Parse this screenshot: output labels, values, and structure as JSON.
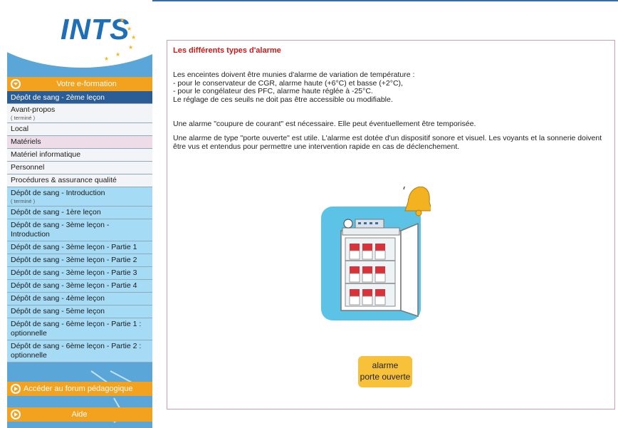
{
  "logo": {
    "text": "INTS"
  },
  "sidebar": {
    "formation_label": "Votre e-formation",
    "items": [
      {
        "label": "Dépôt de sang - 2ème leçon",
        "style": "active"
      },
      {
        "label": "Avant-propos",
        "sub": "( terminé )",
        "style": "white"
      },
      {
        "label": "Local",
        "style": "white"
      },
      {
        "label": "Matériels",
        "style": "pink"
      },
      {
        "label": "Matériel informatique",
        "style": "white"
      },
      {
        "label": "Personnel",
        "style": "white"
      },
      {
        "label": "Procédures & assurance qualité",
        "style": "white"
      },
      {
        "label": "Dépôt de sang - Introduction",
        "sub": "( terminé )",
        "style": "blue"
      },
      {
        "label": "Dépôt de sang - 1ère leçon",
        "style": "blue"
      },
      {
        "label": "Dépôt de sang - 3ème leçon - Introduction",
        "style": "blue"
      },
      {
        "label": "Dépôt de sang - 3ème leçon - Partie 1",
        "style": "blue"
      },
      {
        "label": "Dépôt de sang - 3ème leçon - Partie 2",
        "style": "blue"
      },
      {
        "label": "Dépôt de sang - 3ème leçon - Partie 3",
        "style": "blue"
      },
      {
        "label": "Dépôt de sang - 3ème leçon - Partie 4",
        "style": "blue"
      },
      {
        "label": "Dépôt de sang - 4ème leçon",
        "style": "blue"
      },
      {
        "label": "Dépôt de sang - 5ème leçon",
        "style": "blue"
      },
      {
        "label": "Dépôt de sang - 6ème leçon - Partie 1 : optionnelle",
        "style": "blue"
      },
      {
        "label": "Dépôt de sang - 6ème leçon - Partie 2 : optionnelle",
        "style": "blue"
      }
    ],
    "forum_label": "Accéder au forum pédagogique",
    "help_label": "Aide"
  },
  "content": {
    "title": "Les différents types d'alarme",
    "para1": [
      "Les enceintes doivent être munies d'alarme de variation de température :",
      "- pour le conservateur de CGR, alarme haute (+6°C) et basse (+2°C),",
      "- pour le congélateur des PFC, alarme haute réglée à -25°C.",
      "Le réglage de ces seuils ne doit pas être accessible ou modifiable."
    ],
    "para2": "Une alarme \"coupure de courant\" est nécessaire. Elle peut éventuellement être temporisée.",
    "para3": "Une alarme de type \"porte ouverte\" est utile. L'alarme est dotée d'un dispositif sonore et visuel. Les voyants et la sonnerie doivent être vus et entendus pour permettre une intervention rapide en cas de déclenchement.",
    "tag_line1": "alarme",
    "tag_line2": "porte ouverte"
  },
  "colors": {
    "sidebar_bg": "#5aa6d8",
    "orange": "#f3a21f",
    "active": "#2a5d96",
    "title_red": "#cc1a1a",
    "bell": "#f3b21f",
    "tag": "#f7c23a"
  }
}
